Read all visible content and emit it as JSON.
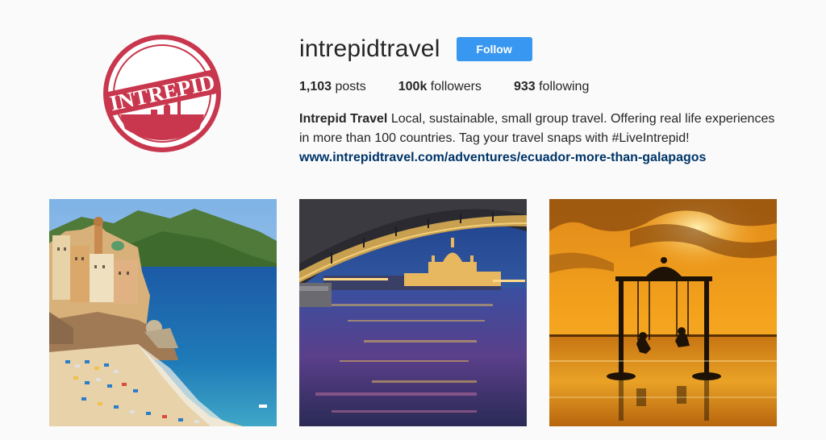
{
  "profile": {
    "username": "intrepidtravel",
    "follow_label": "Follow",
    "logo_text": "INTREPID",
    "stats": {
      "posts_count": "1,103",
      "posts_label": "posts",
      "followers_count": "100k",
      "followers_label": "followers",
      "following_count": "933",
      "following_label": "following"
    },
    "bio": {
      "name": "Intrepid Travel",
      "text": "Local, sustainable, small group travel. Offering real life experiences in more than 100 countries. Tag your travel snaps with #LiveIntrepid!",
      "link": "www.intrepidtravel.com/adventures/ecuador-more-than-galapagos"
    }
  },
  "colors": {
    "follow_button": "#3897f0",
    "logo_red": "#c8374d",
    "link": "#003569",
    "background": "#fafafa"
  },
  "posts": [
    {
      "subject": "coastal-village-beach"
    },
    {
      "subject": "bridge-over-river-at-dusk"
    },
    {
      "subject": "swing-at-sunset-beach"
    }
  ]
}
